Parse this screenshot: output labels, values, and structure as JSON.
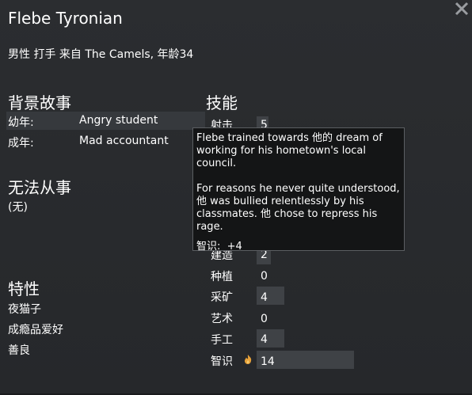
{
  "character": {
    "name": "Flebe Tyronian",
    "subtitle": "男性 打手 来自 The Camels, 年龄34"
  },
  "backstory": {
    "title": "背景故事",
    "childhood_label": "幼年:",
    "childhood_value": "Angry student",
    "adulthood_label": "成年:",
    "adulthood_value": "Mad accountant"
  },
  "incapable": {
    "title": "无法从事",
    "value": "(无)"
  },
  "traits": {
    "title": "特性",
    "items": [
      "夜猫子",
      "成瘾品爱好",
      "善良"
    ]
  },
  "skills": {
    "title": "技能",
    "items": [
      {
        "label": "射击",
        "value": "5",
        "level": 5
      },
      {
        "label": "建造",
        "value": "2",
        "level": 2
      },
      {
        "label": "种植",
        "value": "0",
        "level": 0
      },
      {
        "label": "采矿",
        "value": "4",
        "level": 4
      },
      {
        "label": "艺术",
        "value": "0",
        "level": 0
      },
      {
        "label": "手工",
        "value": "4",
        "level": 4
      },
      {
        "label": "智识",
        "value": "14",
        "level": 14,
        "passion": "flame-icon"
      }
    ]
  },
  "tooltip": {
    "line1": "Flebe trained towards 他的 dream of",
    "line2": "working for his hometown's local council.",
    "line3": "For reasons he never quite understood,",
    "line4": "他 was bullied relentlessly by his",
    "line5": "classmates. 他 chose to repress his",
    "line6": "rage.",
    "stat_label": "智识:",
    "stat_value": "+4"
  },
  "colors": {
    "background": "#2a2c2f",
    "tooltip_bg": "#141516",
    "skill_bar": "#3f4246",
    "passion": "#e8a23a"
  }
}
